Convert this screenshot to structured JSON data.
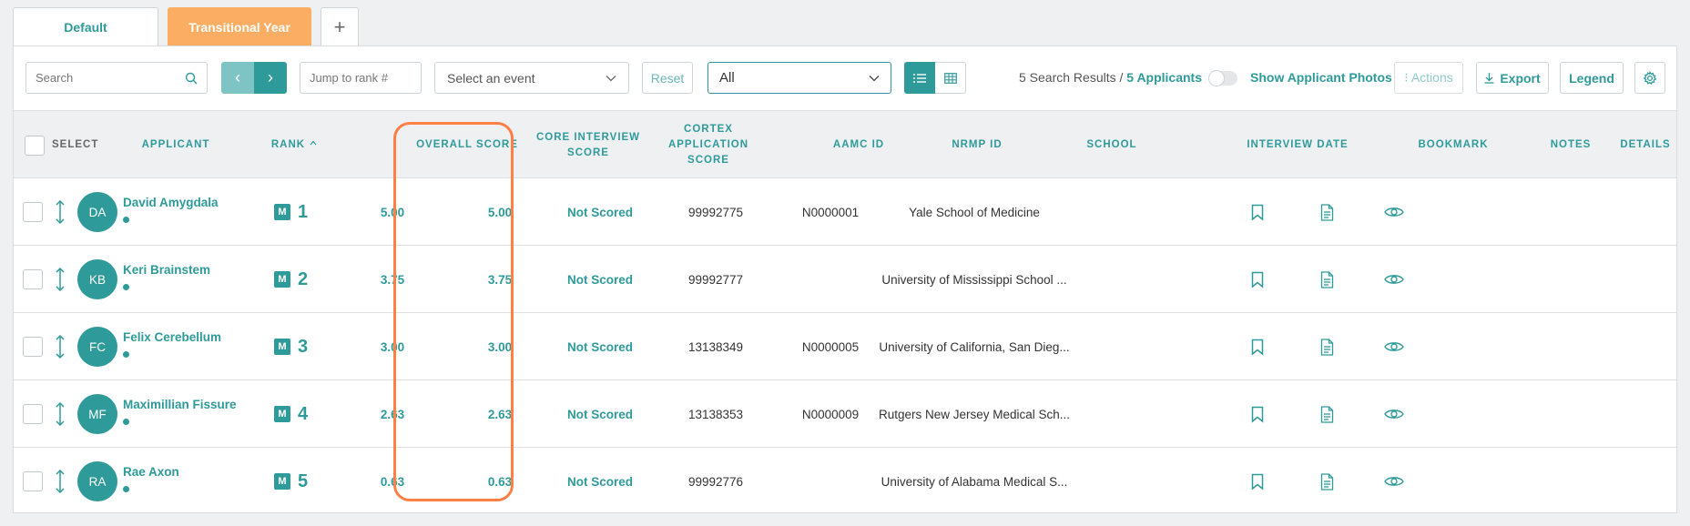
{
  "tabs": [
    {
      "label": "Default"
    },
    {
      "label": "Transitional Year"
    },
    {
      "label": "+"
    }
  ],
  "toolbar": {
    "search_placeholder": "Search",
    "jump_placeholder": "Jump to rank #",
    "event_placeholder": "Select an event",
    "reset_label": "Reset",
    "filter_value": "All",
    "results_count": "5 Search Results",
    "results_sep": " / ",
    "results_applicants": "5 Applicants",
    "photos_label": "Show Applicant Photos",
    "actions_label": "⁝ Actions",
    "export_label": "Export",
    "legend_label": "Legend"
  },
  "columns": {
    "select": "SELECT",
    "applicant": "APPLICANT",
    "rank": "RANK",
    "overall": "OVERALL SCORE",
    "core": "CORE INTERVIEW SCORE",
    "cortex": "CORTEX APPLICATION SCORE",
    "aamc": "AAMC ID",
    "nrmp": "NRMP ID",
    "school": "SCHOOL",
    "interview_date": "INTERVIEW DATE",
    "bookmark": "BOOKMARK",
    "notes": "NOTES",
    "details": "DETAILS"
  },
  "rows": [
    {
      "initials": "DA",
      "name": "David Amygdala",
      "badge": "M",
      "rank": "1",
      "overall": "5.00",
      "core": "5.00",
      "cortex": "Not Scored",
      "aamc": "99992775",
      "nrmp": "N0000001",
      "school": "Yale School of Medicine"
    },
    {
      "initials": "KB",
      "name": "Keri Brainstem",
      "badge": "M",
      "rank": "2",
      "overall": "3.75",
      "core": "3.75",
      "cortex": "Not Scored",
      "aamc": "99992777",
      "nrmp": "",
      "school": "University of Mississippi School ..."
    },
    {
      "initials": "FC",
      "name": "Felix Cerebellum",
      "badge": "M",
      "rank": "3",
      "overall": "3.00",
      "core": "3.00",
      "cortex": "Not Scored",
      "aamc": "13138349",
      "nrmp": "N0000005",
      "school": "University of California, San Dieg..."
    },
    {
      "initials": "MF",
      "name": "Maximillian Fissure",
      "badge": "M",
      "rank": "4",
      "overall": "2.63",
      "core": "2.63",
      "cortex": "Not Scored",
      "aamc": "13138353",
      "nrmp": "N0000009",
      "school": "Rutgers New Jersey Medical Sch..."
    },
    {
      "initials": "RA",
      "name": "Rae Axon",
      "badge": "M",
      "rank": "5",
      "overall": "0.63",
      "core": "0.63",
      "cortex": "Not Scored",
      "aamc": "99992776",
      "nrmp": "",
      "school": "University of Alabama Medical S..."
    }
  ],
  "colors": {
    "accent": "#2f9a9a",
    "tab_active": "#fbad63",
    "highlight": "#ff7f44"
  }
}
